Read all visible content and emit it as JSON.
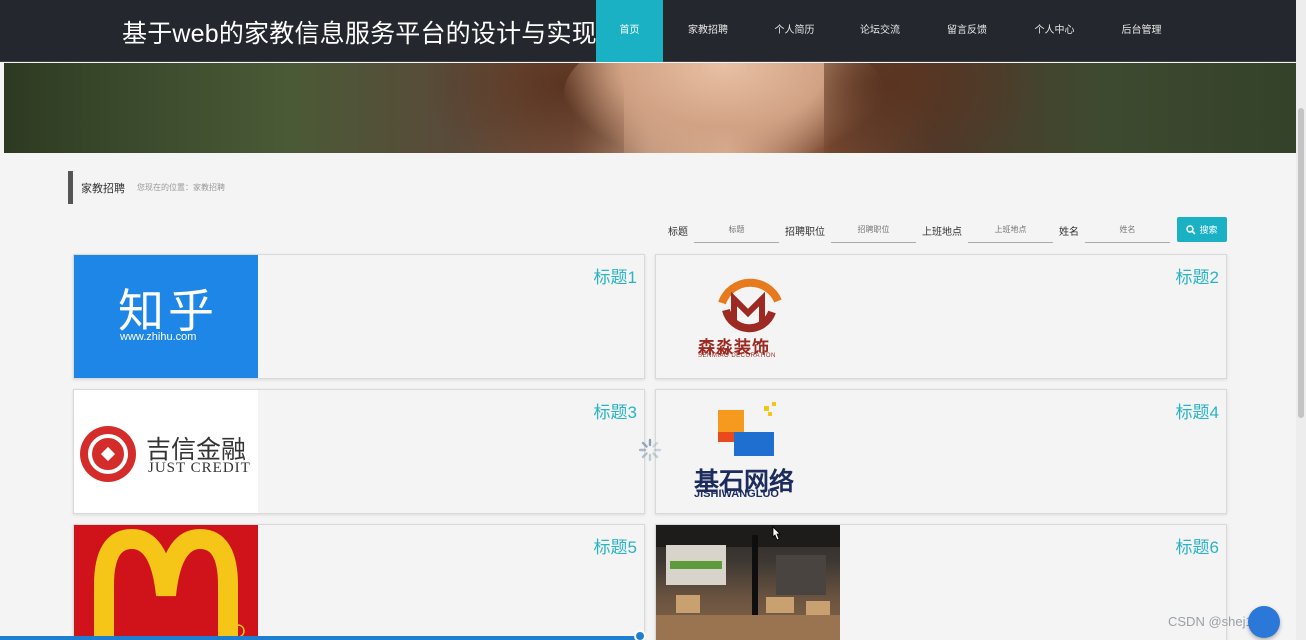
{
  "header": {
    "site_title": "基于web的家教信息服务平台的设计与实现",
    "nav": [
      "首页",
      "家教招聘",
      "个人简历",
      "论坛交流",
      "留言反馈",
      "个人中心",
      "后台管理"
    ],
    "active_index": 0
  },
  "breadcrumb": {
    "title": "家教招聘",
    "path": "您现在的位置：家教招聘"
  },
  "search": {
    "fields": [
      {
        "label": "标题",
        "placeholder": "标题"
      },
      {
        "label": "招聘职位",
        "placeholder": "招聘职位"
      },
      {
        "label": "上班地点",
        "placeholder": "上班地点"
      },
      {
        "label": "姓名",
        "placeholder": "姓名"
      }
    ],
    "button_label": "搜索"
  },
  "cards": [
    {
      "title": "标题1",
      "logo": {
        "main": "知乎",
        "sub": "www.zhihu.com"
      }
    },
    {
      "title": "标题2",
      "logo": {
        "main": "森淼装饰",
        "sub": "SENMIAO DECORATION"
      }
    },
    {
      "title": "标题3",
      "logo": {
        "main": "吉信金融",
        "sub": "JUST CREDIT"
      }
    },
    {
      "title": "标题4",
      "logo": {
        "main": "基石网络",
        "sub": "JISHIWANGLUO"
      }
    },
    {
      "title": "标题5",
      "logo": {
        "main": "",
        "sub": ""
      }
    },
    {
      "title": "标题6",
      "logo": {
        "main": "",
        "sub": ""
      }
    }
  ],
  "watermark": "CSDN @shej1011",
  "colors": {
    "accent": "#1bb1c4",
    "header_bg": "#24272d",
    "card_title": "#2ab4c5"
  }
}
